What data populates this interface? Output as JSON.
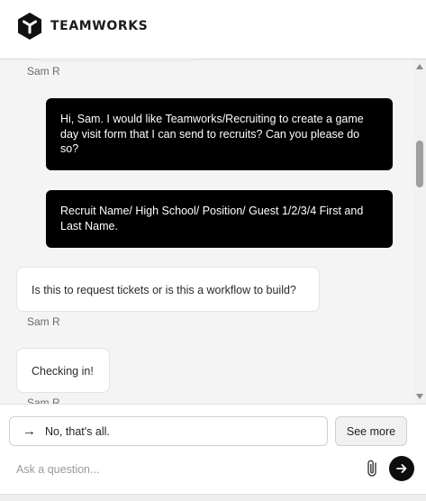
{
  "header": {
    "brand": "TEAMWORKS"
  },
  "messages": [
    {
      "sender": "Sam R"
    },
    {
      "role": "user",
      "text": "Hi, Sam. I would like Teamworks/Recruiting to create a game day visit form that I can send to recruits? Can you please do so?"
    },
    {
      "role": "user",
      "text": "Recruit Name/ High School/ Position/ Guest 1/2/3/4 First and Last Name."
    },
    {
      "role": "agent",
      "text": "Is this to request tickets or is this a workflow to build?",
      "sender": "Sam R"
    },
    {
      "role": "agent",
      "text": "Checking in!",
      "sender": "Sam R"
    }
  ],
  "composer": {
    "quick_reply": "No, that's all.",
    "see_more": "See more",
    "placeholder": "Ask a question..."
  },
  "colors": {
    "user_bubble": "#000000",
    "chat_background": "#f4f4f4"
  }
}
